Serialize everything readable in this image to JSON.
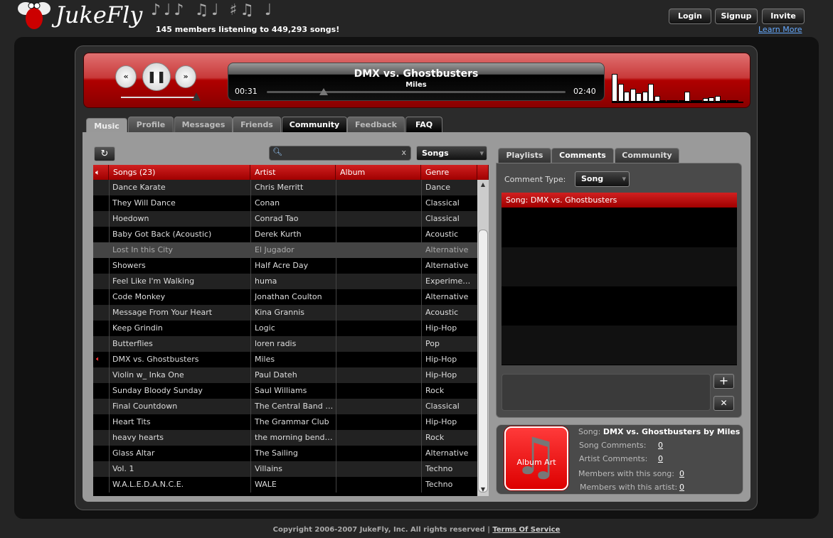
{
  "header": {
    "logo": "JukeFly",
    "tagline": "145 members listening to 449,293 songs!",
    "login": "Login",
    "signup": "Signup",
    "invite": "Invite",
    "learn_more": "Learn More"
  },
  "player": {
    "title": "DMX vs. Ghostbusters",
    "artist": "Miles",
    "elapsed": "00:31",
    "total": "02:40",
    "progress": 0.19,
    "volume": 1.0,
    "visualizer": [
      0.95,
      0.6,
      0.35,
      0.45,
      0.3,
      0.35,
      0.6,
      0.2,
      0.05,
      0.05,
      0.02,
      0.02,
      0.35,
      0.05,
      0.02,
      0.12,
      0.15,
      0.2,
      0.02,
      0.02,
      0.02
    ]
  },
  "tabs": [
    "Music",
    "Profile",
    "Messages",
    "Friends",
    "Community",
    "Feedback",
    "FAQ"
  ],
  "search": {
    "value": "",
    "clear": "x",
    "scope": "Songs"
  },
  "table": {
    "headers": [
      "Songs (23)",
      "Artist",
      "Album",
      "Genre"
    ],
    "rows": [
      [
        "Dance Karate",
        "Chris Merritt",
        "",
        "Dance"
      ],
      [
        "They Will Dance",
        "Conan",
        "",
        "Classical"
      ],
      [
        "Hoedown",
        "Conrad Tao",
        "",
        "Classical"
      ],
      [
        "Baby Got Back (Acoustic)",
        "Derek Kurth",
        "",
        "Acoustic"
      ],
      [
        "Lost In this City",
        "El Jugador",
        "",
        "Alternative"
      ],
      [
        "Showers",
        "Half Acre Day",
        "",
        "Alternative"
      ],
      [
        "Feel Like I'm Walking",
        "huma",
        "",
        "Experimental"
      ],
      [
        "Code Monkey",
        "Jonathan Coulton",
        "",
        "Alternative"
      ],
      [
        "Message From Your Heart",
        "Kina Grannis",
        "",
        "Acoustic"
      ],
      [
        "Keep Grindin",
        "Logic",
        "",
        "Hip-Hop"
      ],
      [
        "Butterflies",
        "loren radis",
        "",
        "Pop"
      ],
      [
        "DMX vs. Ghostbusters",
        "Miles",
        "",
        "Hip-Hop"
      ],
      [
        "Violin w_ Inka One",
        "Paul Dateh",
        "",
        "Hip-Hop"
      ],
      [
        "Sunday Bloody Sunday",
        "Saul Williams",
        "",
        "Rock"
      ],
      [
        "Final Countdown",
        "The Central Band of the RAF",
        "",
        "Classical"
      ],
      [
        "Heart Tits",
        "The Grammar Club",
        "",
        "Hip-Hop"
      ],
      [
        "heavy hearts",
        "the morning benders",
        "",
        "Rock"
      ],
      [
        "Glass Altar",
        "The Sailing",
        "",
        "Alternative"
      ],
      [
        "Vol. 1",
        "Villains",
        "",
        "Techno"
      ],
      [
        "W.A.L.E.D.A.N.C.E.",
        "WALE",
        "",
        "Techno"
      ]
    ]
  },
  "right": {
    "tabs": [
      "Playlists",
      "Comments",
      "Community"
    ],
    "comment_type_label": "Comment Type:",
    "comment_type": "Song",
    "comment_header": "Song: DMX vs. Ghostbusters",
    "add": "+",
    "remove": "✕"
  },
  "info": {
    "album_art": "Album Art",
    "song_label": "Song:",
    "song_value": "DMX vs. Ghostbusters by Miles",
    "song_comments_label": "Song Comments:",
    "song_comments": "0",
    "artist_comments_label": "Artist Comments:",
    "artist_comments": "0",
    "members_song_label": "Members with this song:",
    "members_song": "0",
    "members_artist_label": "Members with this artist:",
    "members_artist": "0"
  },
  "footer": {
    "copyright": "Copyright 2006-2007 JukeFly, Inc. All rights reserved  |",
    "tos": "Terms Of Service"
  }
}
